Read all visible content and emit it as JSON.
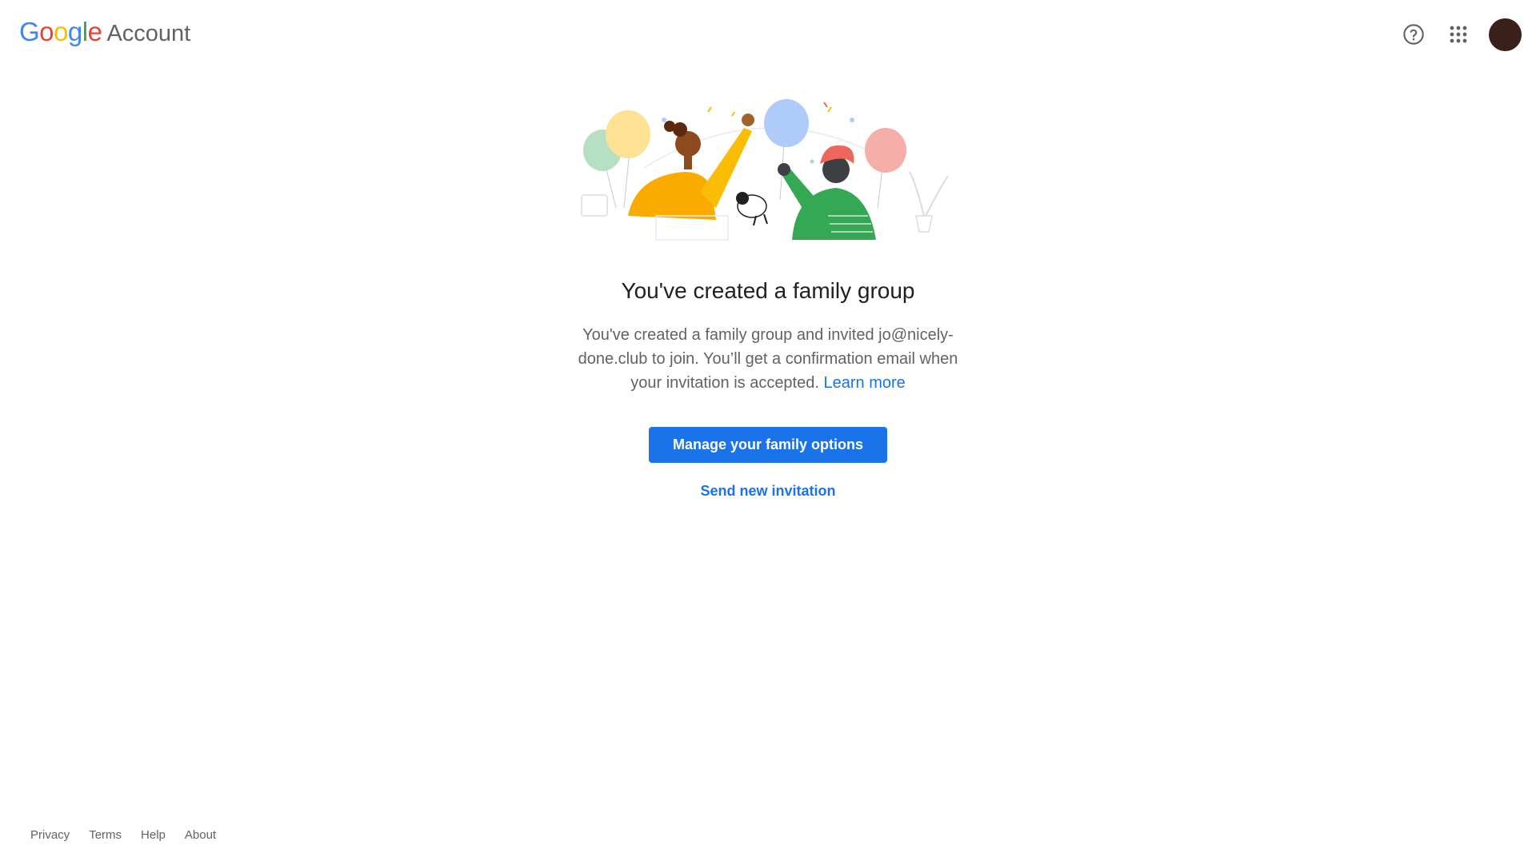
{
  "header": {
    "brand_letters": [
      "G",
      "o",
      "o",
      "g",
      "l",
      "e"
    ],
    "brand_colors": [
      "#4285f4",
      "#ea4335",
      "#fbbc05",
      "#4285f4",
      "#34a853",
      "#ea4335"
    ],
    "product": "Account",
    "help_icon": "help-circle-icon",
    "apps_icon": "apps-grid-icon",
    "avatar_color": "#3a1f1a"
  },
  "main": {
    "title": "You've created a family group",
    "description": "You've created a family group and invited jo@nicely-done.club to join. You’ll get a confirmation email when your invitation is accepted.",
    "learn_more": "Learn more",
    "primary_button": "Manage your family options",
    "secondary_button": "Send new invitation",
    "accent_color": "#1a73e8"
  },
  "footer": {
    "links": [
      "Privacy",
      "Terms",
      "Help",
      "About"
    ]
  }
}
